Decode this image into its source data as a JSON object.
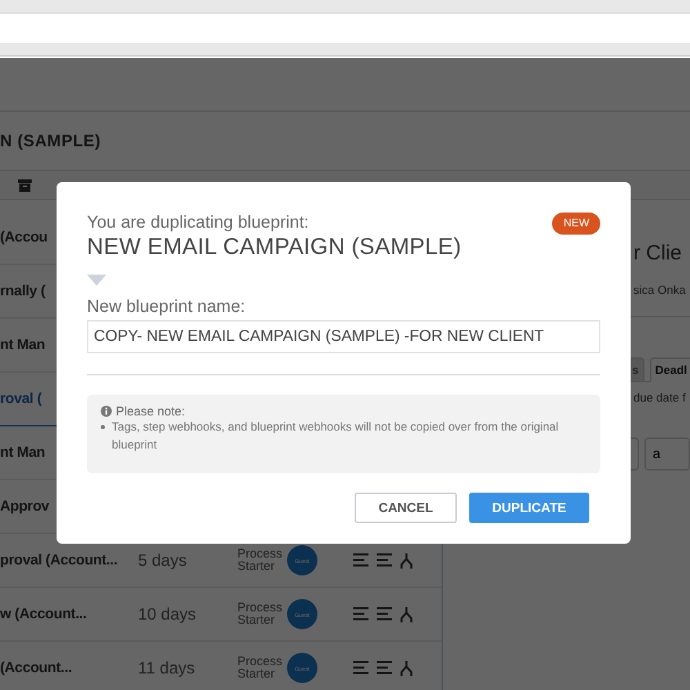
{
  "app": {
    "title": "N (SAMPLE)",
    "rows": [
      {
        "name": "(Accou",
        "selected": false
      },
      {
        "name": "rnally (",
        "selected": false
      },
      {
        "name": "nt Man",
        "selected": false
      },
      {
        "name": "roval (",
        "selected": true
      },
      {
        "name": "nt Man",
        "selected": false
      },
      {
        "name": "Approv",
        "selected": false
      },
      {
        "name": "proval (Account...",
        "duration": "5 days",
        "owner": "Process Starter",
        "avatar": "Guest",
        "selected": false
      },
      {
        "name": "w (Account...",
        "duration": "10 days",
        "owner": "Process Starter",
        "avatar": "Guest",
        "selected": false
      },
      {
        "name": "(Account...",
        "duration": "11 days",
        "owner": "Process Starter",
        "avatar": "Guest",
        "selected": false
      }
    ]
  },
  "detail": {
    "heading": "r Clie",
    "subtitle": "sica Onka",
    "tabs": [
      {
        "label": "s",
        "selected": false
      },
      {
        "label": "Deadl",
        "selected": true
      }
    ],
    "hint": "due date f",
    "second_select": "a"
  },
  "dialog": {
    "intro": "You are duplicating blueprint:",
    "title": "NEW EMAIL CAMPAIGN (SAMPLE)",
    "badge": "NEW",
    "field_label": "New blueprint name:",
    "field_value": "COPY- NEW EMAIL CAMPAIGN (SAMPLE) -FOR NEW CLIENT",
    "note_title": "Please note:",
    "note_items": [
      "Tags, step webhooks, and blueprint webhooks will not be copied over from the original blueprint"
    ],
    "buttons": [
      {
        "label": "CANCEL",
        "kind": "secondary"
      },
      {
        "label": "DUPLICATE",
        "kind": "primary"
      }
    ]
  }
}
